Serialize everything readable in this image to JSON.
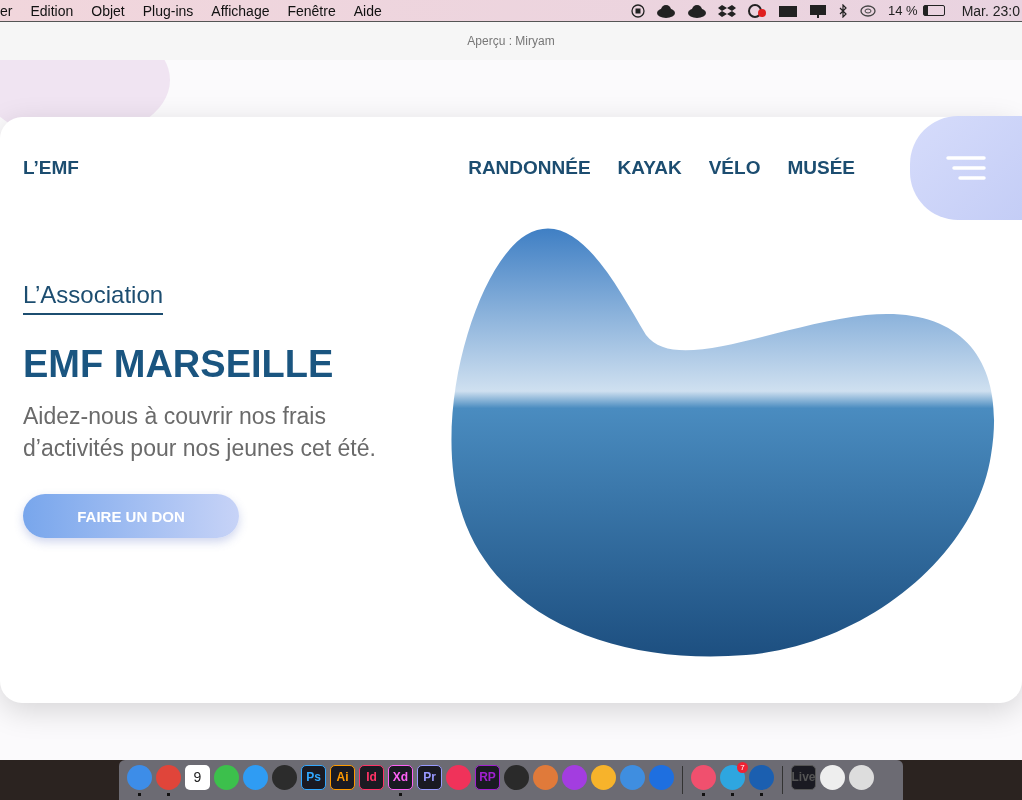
{
  "menubar": {
    "items": [
      "er",
      "Edition",
      "Objet",
      "Plug-ins",
      "Affichage",
      "Fenêtre",
      "Aide"
    ],
    "battery": "14 %",
    "clock": "Mar. 23:0"
  },
  "window": {
    "title": "Aperçu : Miryam"
  },
  "site": {
    "logo": "L’EMF",
    "nav": [
      "RANDONNÉE",
      "KAYAK",
      "VÉLO",
      "MUSÉE"
    ],
    "eyebrow": "L’Association",
    "heading": "EMF MARSEILLE",
    "subtitle": "Aidez-nous à couvrir nos frais d’activités pour nos jeunes cet été.",
    "button": "FAIRE UN DON"
  },
  "dock": [
    {
      "kind": "app",
      "color": "#3d8de8",
      "running": true
    },
    {
      "kind": "app",
      "color": "#e0453a",
      "running": true
    },
    {
      "kind": "calendar",
      "label": "9",
      "running": false
    },
    {
      "kind": "app",
      "color": "#3cc04c",
      "running": false
    },
    {
      "kind": "app",
      "color": "#2f9cf3",
      "running": false
    },
    {
      "kind": "app",
      "color": "#2c2c2c",
      "running": false
    },
    {
      "kind": "tile",
      "label": "Ps",
      "color": "#31a8ff",
      "running": false
    },
    {
      "kind": "tile",
      "label": "Ai",
      "color": "#ff9a00",
      "running": false
    },
    {
      "kind": "tile",
      "label": "Id",
      "color": "#ff3366",
      "running": false
    },
    {
      "kind": "tile",
      "label": "Xd",
      "color": "#ff61f6",
      "running": true
    },
    {
      "kind": "tile",
      "label": "Pr",
      "color": "#9999ff",
      "running": false
    },
    {
      "kind": "app",
      "color": "#f0325a",
      "running": false
    },
    {
      "kind": "tile",
      "label": "RP",
      "color": "#a020d0",
      "running": false
    },
    {
      "kind": "app",
      "color": "#2a2a2a",
      "running": false
    },
    {
      "kind": "app",
      "color": "#e07a3a",
      "running": false
    },
    {
      "kind": "app",
      "color": "#a33de0",
      "running": false
    },
    {
      "kind": "app",
      "color": "#f7b32b",
      "running": false
    },
    {
      "kind": "app",
      "color": "#3f8ee0",
      "running": false
    },
    {
      "kind": "app",
      "color": "#1e6fe0",
      "running": false
    },
    {
      "kind": "separator"
    },
    {
      "kind": "app",
      "color": "#f0506e",
      "running": true
    },
    {
      "kind": "app",
      "color": "#2ea6e0",
      "running": true,
      "badge": "7"
    },
    {
      "kind": "app",
      "color": "#1b5fb0",
      "running": true
    },
    {
      "kind": "separator"
    },
    {
      "kind": "tile",
      "label": "Live",
      "color": "#555555",
      "running": false
    },
    {
      "kind": "app",
      "color": "#eeeeee",
      "running": false
    },
    {
      "kind": "app",
      "color": "#dddddd",
      "running": false
    }
  ]
}
